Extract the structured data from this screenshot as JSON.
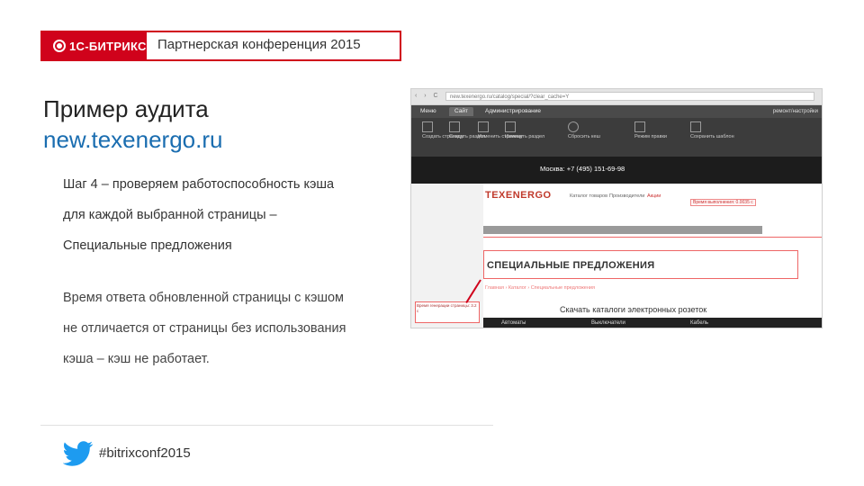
{
  "header": {
    "logo_text": "1С-БИТРИКС",
    "conference": "Партнерская конференция 2015"
  },
  "title": {
    "line1": "Пример аудита",
    "line2": "new.texenergo.ru"
  },
  "step": {
    "line1": "Шаг 4 – проверяем работоспособность кэша",
    "line2": "для каждой выбранной страницы –",
    "line3": "Специальные предложения"
  },
  "result": {
    "line1": "Время ответа обновленной страницы с кэшом",
    "line2": "не отличается от страницы без использования",
    "line3": "кэша – кэш не работает."
  },
  "footer": {
    "hashtag": "#bitrixconf2015"
  },
  "screenshot": {
    "address": "new.texenergo.ru/catalog/special/?clear_cache=Y",
    "nav": "‹ › C",
    "tabs": [
      "Меню",
      "Сайт",
      "Администрирование"
    ],
    "user": "ремонт/настройки",
    "tools": [
      "Создать страницу",
      "Создать раздел",
      "Изменить страницу",
      "Изменить раздел",
      "Сбросить кеш",
      "Режим правки",
      "Сохранить шаблон"
    ],
    "phone": "Москва: +7 (495) 151-69-98",
    "logo": "TEXENERGO",
    "menu_items": [
      "Каталог товаров",
      "Производители",
      "Акции"
    ],
    "special_title": "СПЕЦИАЛЬНЫЕ ПРЕДЛОЖЕНИЯ",
    "crumbs": "Главная › Каталог › Специальные предложения",
    "download": "Скачать каталоги электронных розеток",
    "bar_items": [
      "Автоматы",
      "Выключатели",
      "Кабель"
    ],
    "debug_total": "Время выполнения: 0.0035 с",
    "debug_left": "Время генерации страницы: 3.2 с"
  },
  "colors": {
    "brand_red": "#d0021b",
    "link_blue": "#1a6db0"
  }
}
